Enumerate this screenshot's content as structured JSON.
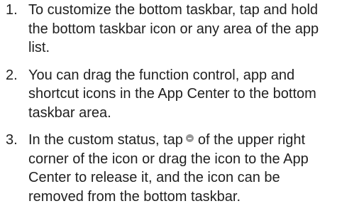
{
  "steps": [
    {
      "number": "1.",
      "text": "To customize the bottom taskbar, tap and hold the bottom taskbar icon or any area of the app list."
    },
    {
      "number": "2.",
      "text": "You can drag the function control, app and shortcut icons in the App Center to the bottom taskbar area."
    },
    {
      "number": "3.",
      "text_before_icon": "In the custom status, tap",
      "icon": "remove-dot-icon",
      "text_after_icon": "of the upper right corner of the icon or drag the icon to the App Center to release it, and the icon can be removed from the bottom taskbar."
    }
  ]
}
